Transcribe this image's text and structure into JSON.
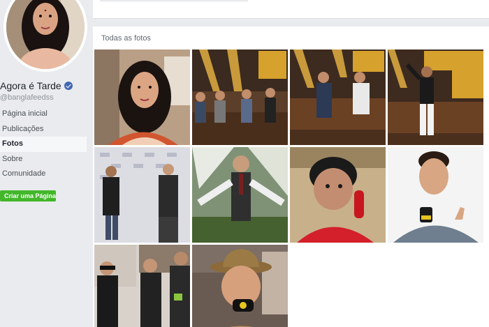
{
  "page": {
    "name": "Agora é Tarde",
    "handle": "@banglafeedss",
    "verified_icon": "verified-badge-icon"
  },
  "nav": [
    {
      "label": "Página inicial",
      "active": false
    },
    {
      "label": "Publicações",
      "active": false
    },
    {
      "label": "Fotos",
      "active": true
    },
    {
      "label": "Sobre",
      "active": false
    },
    {
      "label": "Comunidade",
      "active": false
    }
  ],
  "create_page_label": "Criar uma Página",
  "photos": {
    "title": "Todas as fotos",
    "items": [
      {
        "name": "photo-woman-selfie-car"
      },
      {
        "name": "photo-studio-panel-guests"
      },
      {
        "name": "photo-studio-sofa-interview"
      },
      {
        "name": "photo-studio-dancer"
      },
      {
        "name": "photo-event-backdrop-interview"
      },
      {
        "name": "photo-man-with-tie-outdoors"
      },
      {
        "name": "photo-woman-red-phone"
      },
      {
        "name": "photo-reporter-thumbs-up"
      },
      {
        "name": "photo-band-group"
      },
      {
        "name": "photo-man-hat-microphone"
      }
    ]
  },
  "colors": {
    "background": "#e9ebee",
    "create_button": "#42b72a",
    "verified": "#4267b2"
  }
}
